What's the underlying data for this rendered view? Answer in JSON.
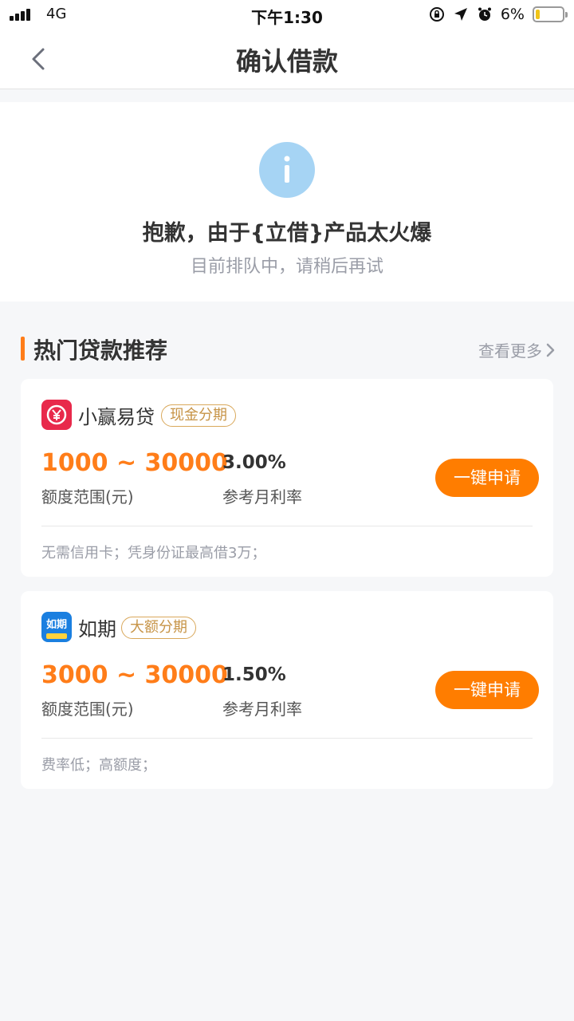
{
  "status_bar": {
    "carrier": "4G",
    "time": "下午1:30",
    "battery": "6%"
  },
  "nav": {
    "title": "确认借款",
    "back_icon": "chevron-left-icon"
  },
  "notice": {
    "icon": "info-icon",
    "title": "抱歉，由于{立借}产品太火爆",
    "subtitle": "目前排队中，请稍后再试"
  },
  "section": {
    "title": "热门贷款推荐",
    "see_more": "查看更多"
  },
  "products": [
    {
      "name": "小赢易贷",
      "tag": "现金分期",
      "amount": "1000 ~ 30000",
      "amount_label": "额度范围(元)",
      "rate": "3.00%",
      "rate_label": "参考月利率",
      "button": "一键申请",
      "feature": "无需信用卡；凭身份证最高借3万；",
      "logo_color": "#e8294b"
    },
    {
      "name": "如期",
      "tag": "大额分期",
      "amount": "3000 ~ 30000",
      "amount_label": "额度范围(元)",
      "rate": "1.50%",
      "rate_label": "参考月利率",
      "button": "一键申请",
      "feature": "费率低；高额度；",
      "logo_color": "#1a7fe0",
      "logo_text": "如期"
    }
  ],
  "colors": {
    "accent": "#ff7d00",
    "info": "#a6d4f4",
    "tag": "#c79447"
  }
}
